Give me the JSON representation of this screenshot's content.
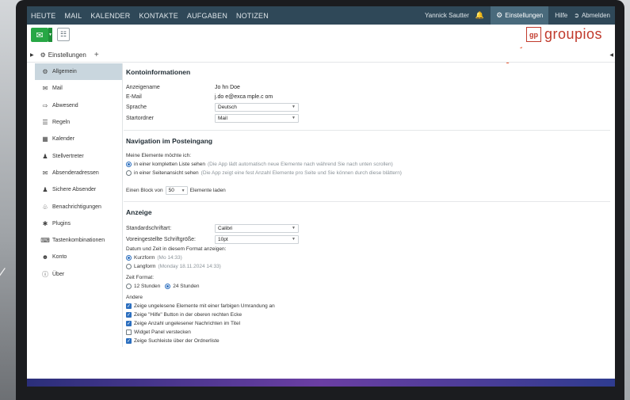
{
  "topnav": {
    "items": [
      "HEUTE",
      "MAIL",
      "KALENDER",
      "KONTAKTE",
      "AUFGABEN",
      "NOTIZEN"
    ],
    "user": "Yannick Sautter",
    "settings": "Einstellungen",
    "help": "Hilfe",
    "logout": "Abmelden"
  },
  "logo": {
    "mark": "gp",
    "text": "groupios"
  },
  "tabs": {
    "active": "Einstellungen",
    "add": "+"
  },
  "sidebar": {
    "items": [
      {
        "label": "Allgemein",
        "icon": "gear-icon",
        "active": true
      },
      {
        "label": "Mail",
        "icon": "envelope-icon"
      },
      {
        "label": "Abwesend",
        "icon": "away-icon"
      },
      {
        "label": "Regeln",
        "icon": "rules-icon"
      },
      {
        "label": "Kalender",
        "icon": "calendar-icon"
      },
      {
        "label": "Stellvertreter",
        "icon": "users-icon"
      },
      {
        "label": "Absenderadressen",
        "icon": "sender-icon"
      },
      {
        "label": "Sichere Absender",
        "icon": "users-icon"
      },
      {
        "label": "Benachrichtigungen",
        "icon": "bell-icon"
      },
      {
        "label": "Plugins",
        "icon": "puzzle-icon"
      },
      {
        "label": "Tastenkombinationen",
        "icon": "keyboard-icon"
      },
      {
        "label": "Konto",
        "icon": "account-icon"
      },
      {
        "label": "Über",
        "icon": "info-icon"
      }
    ]
  },
  "account": {
    "title": "Kontoinformationen",
    "name_label": "Anzeigename",
    "name_value": "Jo hn Doe",
    "email_label": "E-Mail",
    "email_value": "j.do e@exca mple.c om",
    "language_label": "Sprache",
    "language_value": "Deutsch",
    "startfolder_label": "Startordner",
    "startfolder_value": "Mail"
  },
  "navigation": {
    "title": "Navigation im Posteingang",
    "intro": "Meine Elemente möchte ich:",
    "option1": "in einer kompletten Liste sehen",
    "option1_hint": "(Die App lädt automatisch neue Elemente nach während Sie nach unten scrollen)",
    "option2": "in einer Seitenansicht sehen",
    "option2_hint": "(Die App zeigt eine fest Anzahl Elemente pro Seite und Sie können durch diese blättern)",
    "block_prefix": "Einen Block von",
    "block_value": "50",
    "block_suffix": "Elemente laden"
  },
  "display": {
    "title": "Anzeige",
    "font_label": "Standardschriftart:",
    "font_value": "Calibri",
    "size_label": "Voreingestellte Schriftgröße:",
    "size_value": "10pt",
    "date_intro": "Datum und Zeit in diesem Format anzeigen:",
    "short_label": "Kurzform",
    "short_hint": "(Mo 14:33)",
    "long_label": "Langform",
    "long_hint": "(Monday 18.11.2024 14:33)",
    "time_intro": "Zeit Format:",
    "h12": "12 Stunden",
    "h24": "24 Stunden",
    "other_intro": "Andere",
    "checks": [
      {
        "label": "Zeige ungelesene Elemente mit einer farbigen Umrandung an",
        "checked": true
      },
      {
        "label": "Zeige \"Hilfe\" Button in der oberen rechten Ecke",
        "checked": true
      },
      {
        "label": "Zeige Anzahl ungelesener Nachrichten im Titel",
        "checked": true
      },
      {
        "label": "Widget Panel verstecken",
        "checked": false
      },
      {
        "label": "Zeige Suchleiste über der Ordnerliste",
        "checked": true
      }
    ]
  },
  "colors": {
    "nav": "#2f4858",
    "accent_green": "#27a745",
    "brand_red": "#c0392b",
    "annotation": "#e8512a"
  }
}
